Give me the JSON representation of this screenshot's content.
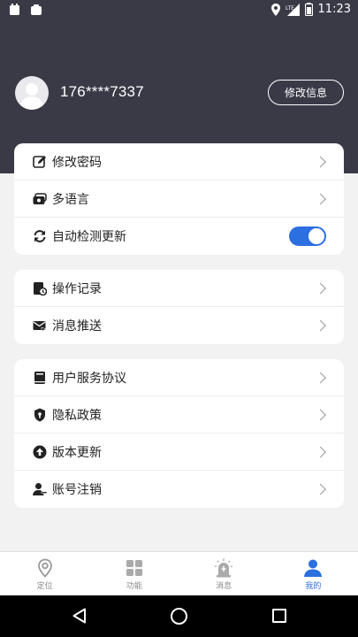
{
  "status_bar": {
    "time": "11:23",
    "network": "LTE"
  },
  "profile": {
    "phone": "176****7337",
    "edit_button": "修改信息"
  },
  "group1": [
    {
      "label": "修改密码",
      "icon": "edit-icon",
      "control": "chevron"
    },
    {
      "label": "多语言",
      "icon": "language-icon",
      "control": "chevron"
    },
    {
      "label": "自动检测更新",
      "icon": "refresh-icon",
      "control": "toggle",
      "toggle_on": true
    }
  ],
  "group2": [
    {
      "label": "操作记录",
      "icon": "history-icon",
      "control": "chevron"
    },
    {
      "label": "消息推送",
      "icon": "mail-icon",
      "control": "chevron"
    }
  ],
  "group3": [
    {
      "label": "用户服务协议",
      "icon": "book-icon",
      "control": "chevron"
    },
    {
      "label": "隐私政策",
      "icon": "shield-icon",
      "control": "chevron"
    },
    {
      "label": "版本更新",
      "icon": "upload-icon",
      "control": "chevron"
    },
    {
      "label": "账号注销",
      "icon": "remove-user-icon",
      "control": "chevron"
    }
  ],
  "tabs": [
    {
      "label": "定位",
      "icon": "location-icon",
      "active": false
    },
    {
      "label": "功能",
      "icon": "grid-icon",
      "active": false
    },
    {
      "label": "消息",
      "icon": "alarm-icon",
      "active": false
    },
    {
      "label": "我的",
      "icon": "person-icon",
      "active": true
    }
  ],
  "colors": {
    "header": "#3a3a47",
    "accent": "#2b6fe0",
    "background": "#f2f2f2"
  }
}
